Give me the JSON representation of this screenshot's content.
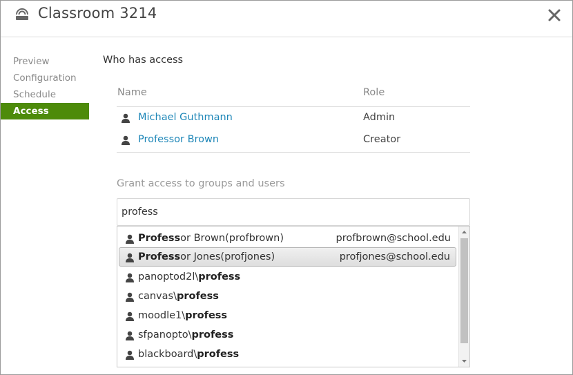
{
  "header": {
    "title": "Classroom 3214",
    "icon": "remote-recorder-icon",
    "close_icon": "close-icon"
  },
  "sidebar": {
    "items": [
      {
        "label": "Preview",
        "active": false
      },
      {
        "label": "Configuration",
        "active": false
      },
      {
        "label": "Schedule",
        "active": false
      },
      {
        "label": "Access",
        "active": true
      }
    ],
    "active_color": "#4d8b0a"
  },
  "access": {
    "section_title": "Who has access",
    "columns": {
      "name": "Name",
      "role": "Role"
    },
    "rows": [
      {
        "name": "Michael Guthmann",
        "role": "Admin"
      },
      {
        "name": "Professor Brown",
        "role": "Creator"
      }
    ],
    "link_color": "#1f87b8"
  },
  "grant": {
    "label": "Grant access to groups and users",
    "search_value": "profess"
  },
  "suggestions": [
    {
      "bold": "Profess",
      "rest": "or Brown(profbrown)",
      "prefix": "",
      "email": "profbrown@school.edu",
      "highlighted": false
    },
    {
      "bold": "Profess",
      "rest": "or Jones(profjones)",
      "prefix": "",
      "email": "profjones@school.edu",
      "highlighted": true
    },
    {
      "prefix": "panoptod2l\\",
      "bold": "profess",
      "rest": "",
      "email": "",
      "highlighted": false
    },
    {
      "prefix": "canvas\\",
      "bold": "profess",
      "rest": "",
      "email": "",
      "highlighted": false
    },
    {
      "prefix": "moodle1\\",
      "bold": "profess",
      "rest": "",
      "email": "",
      "highlighted": false
    },
    {
      "prefix": "sfpanopto\\",
      "bold": "profess",
      "rest": "",
      "email": "",
      "highlighted": false
    },
    {
      "prefix": "blackboard\\",
      "bold": "profess",
      "rest": "",
      "email": "",
      "highlighted": false
    }
  ]
}
